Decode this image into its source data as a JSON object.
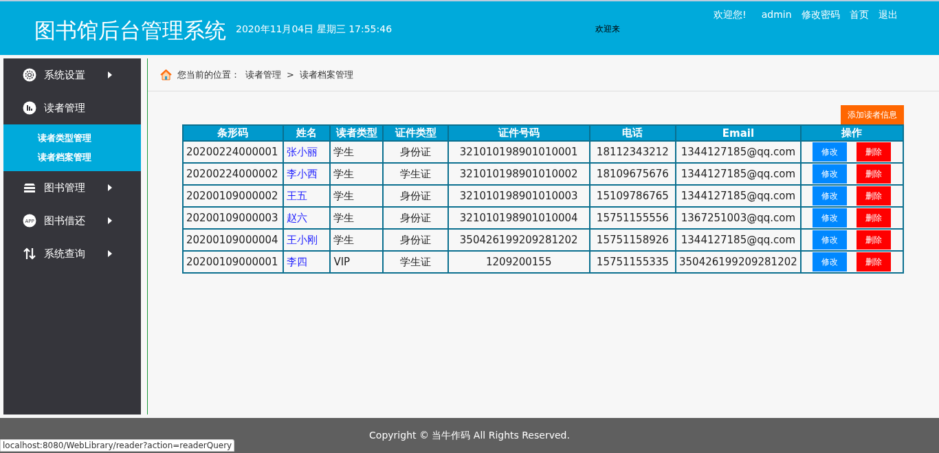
{
  "header": {
    "title": "图书馆后台管理系统",
    "datetime": "2020年11月04日 星期三 17:55:46",
    "marquee": "欢迎来",
    "welcome": "欢迎您!",
    "user": "admin",
    "links": [
      "修改密码",
      "首页",
      "退出"
    ]
  },
  "sidebar": {
    "items": [
      {
        "label": "系统设置",
        "kind": "gear",
        "expanded": false
      },
      {
        "label": "读者管理",
        "kind": "chart",
        "expanded": true,
        "children": [
          {
            "label": "读者类型管理"
          },
          {
            "label": "读者档案管理"
          }
        ]
      },
      {
        "label": "图书管理",
        "kind": "stack",
        "expanded": false
      },
      {
        "label": "图书借还",
        "kind": "app",
        "icon_text": "APP",
        "expanded": false
      },
      {
        "label": "系统查询",
        "kind": "arrows",
        "expanded": false
      }
    ]
  },
  "breadcrumb": {
    "prefix": "您当前的位置：",
    "path": [
      "读者管理",
      "读者档案管理"
    ],
    "separator": ">"
  },
  "add_button": "添加读者信息",
  "table": {
    "columns": [
      "条形码",
      "姓名",
      "读者类型",
      "证件类型",
      "证件号码",
      "电话",
      "Email",
      "操作"
    ],
    "rows": [
      {
        "cells": [
          "20200224000001",
          "张小丽",
          "学生",
          "身份证",
          "321010198901010001",
          "18112343212",
          "1344127185@qq.com"
        ],
        "actions": [
          "修改",
          "删除"
        ]
      },
      {
        "cells": [
          "20200224000002",
          "李小西",
          "学生",
          "学生证",
          "321010198901010002",
          "18109675676",
          "1344127185@qq.com"
        ],
        "actions": [
          "修改",
          "删除"
        ]
      },
      {
        "cells": [
          "20200109000002",
          "王五",
          "学生",
          "身份证",
          "321010198901010003",
          "15109786765",
          "1344127185@qq.com"
        ],
        "actions": [
          "修改",
          "删除"
        ]
      },
      {
        "cells": [
          "20200109000003",
          "赵六",
          "学生",
          "身份证",
          "321010198901010004",
          "15751155556",
          "1367251003@qq.com"
        ],
        "actions": [
          "修改",
          "删除"
        ]
      },
      {
        "cells": [
          "20200109000004",
          "王小刚",
          "学生",
          "身份证",
          "350426199209281202",
          "15751158926",
          "1344127185@qq.com"
        ],
        "actions": [
          "修改",
          "删除"
        ]
      },
      {
        "cells": [
          "20200109000001",
          "李四",
          "VIP",
          "学生证",
          "1209200155",
          "15751155335",
          "350426199209281202"
        ],
        "actions": [
          "修改",
          "删除"
        ]
      }
    ]
  },
  "footer": "Copyright © 当牛作码 All Rights Reserved.",
  "status_bar": "localhost:8080/WebLibrary/reader?action=readerQuery"
}
